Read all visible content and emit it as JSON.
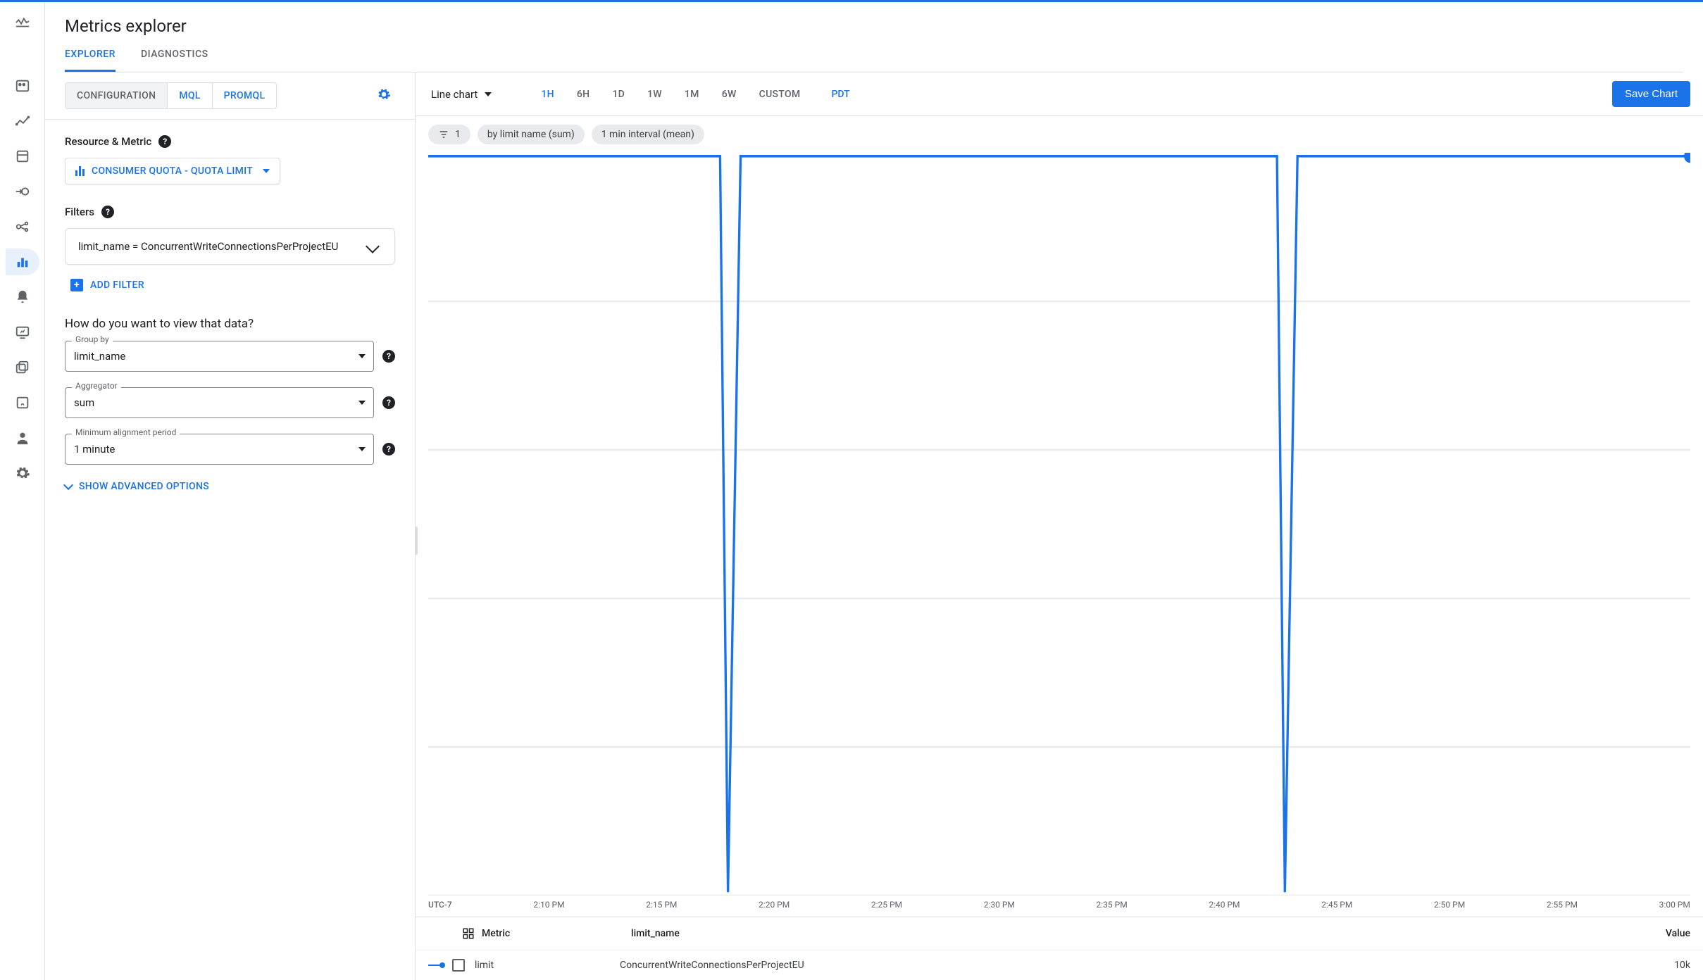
{
  "header": {
    "title": "Metrics explorer"
  },
  "tabs": {
    "explorer": "EXPLORER",
    "diagnostics": "DIAGNOSTICS"
  },
  "subtabs": {
    "configuration": "CONFIGURATION",
    "mql": "MQL",
    "promql": "PROMQL"
  },
  "config": {
    "resource_metric_label": "Resource & Metric",
    "metric_chip": "CONSUMER QUOTA - QUOTA LIMIT",
    "filters_label": "Filters",
    "filter_text": "limit_name = ConcurrentWriteConnectionsPerProjectEU",
    "add_filter": "ADD FILTER",
    "view_heading": "How do you want to view that data?",
    "group_by": {
      "label": "Group by",
      "value": "limit_name"
    },
    "aggregator": {
      "label": "Aggregator",
      "value": "sum"
    },
    "min_align": {
      "label": "Minimum alignment period",
      "value": "1 minute"
    },
    "show_advanced": "SHOW ADVANCED OPTIONS"
  },
  "chart": {
    "type_label": "Line chart",
    "time_ranges": [
      "1H",
      "6H",
      "1D",
      "1W",
      "1M",
      "6W",
      "CUSTOM"
    ],
    "timezone": "PDT",
    "save_label": "Save Chart",
    "chips": {
      "count": "1",
      "groupby": "by limit name (sum)",
      "interval": "1 min interval (mean)"
    },
    "x_ticks": [
      "UTC-7",
      "2:10 PM",
      "2:15 PM",
      "2:20 PM",
      "2:25 PM",
      "2:30 PM",
      "2:35 PM",
      "2:40 PM",
      "2:45 PM",
      "2:50 PM",
      "2:55 PM",
      "3:00 PM"
    ],
    "legend": {
      "col_metric": "Metric",
      "col_limit": "limit_name",
      "col_value": "Value",
      "row": {
        "metric": "limit",
        "limit_name": "ConcurrentWriteConnectionsPerProjectEU",
        "value": "10k"
      }
    }
  },
  "chart_data": {
    "type": "line",
    "title": "",
    "xlabel": "UTC-7",
    "ylabel": "",
    "x": [
      "2:05 PM",
      "2:10 PM",
      "2:15 PM",
      "2:16 PM",
      "2:17 PM",
      "2:20 PM",
      "2:25 PM",
      "2:30 PM",
      "2:35 PM",
      "2:40 PM",
      "2:41 PM",
      "2:42 PM",
      "2:45 PM",
      "2:50 PM",
      "2:55 PM",
      "3:00 PM"
    ],
    "series": [
      {
        "name": "limit",
        "limit_name": "ConcurrentWriteConnectionsPerProjectEU",
        "values": [
          10000,
          10000,
          10000,
          0,
          10000,
          10000,
          10000,
          10000,
          10000,
          10000,
          0,
          10000,
          10000,
          10000,
          10000,
          10000
        ]
      }
    ],
    "ylim": [
      0,
      10000
    ]
  }
}
